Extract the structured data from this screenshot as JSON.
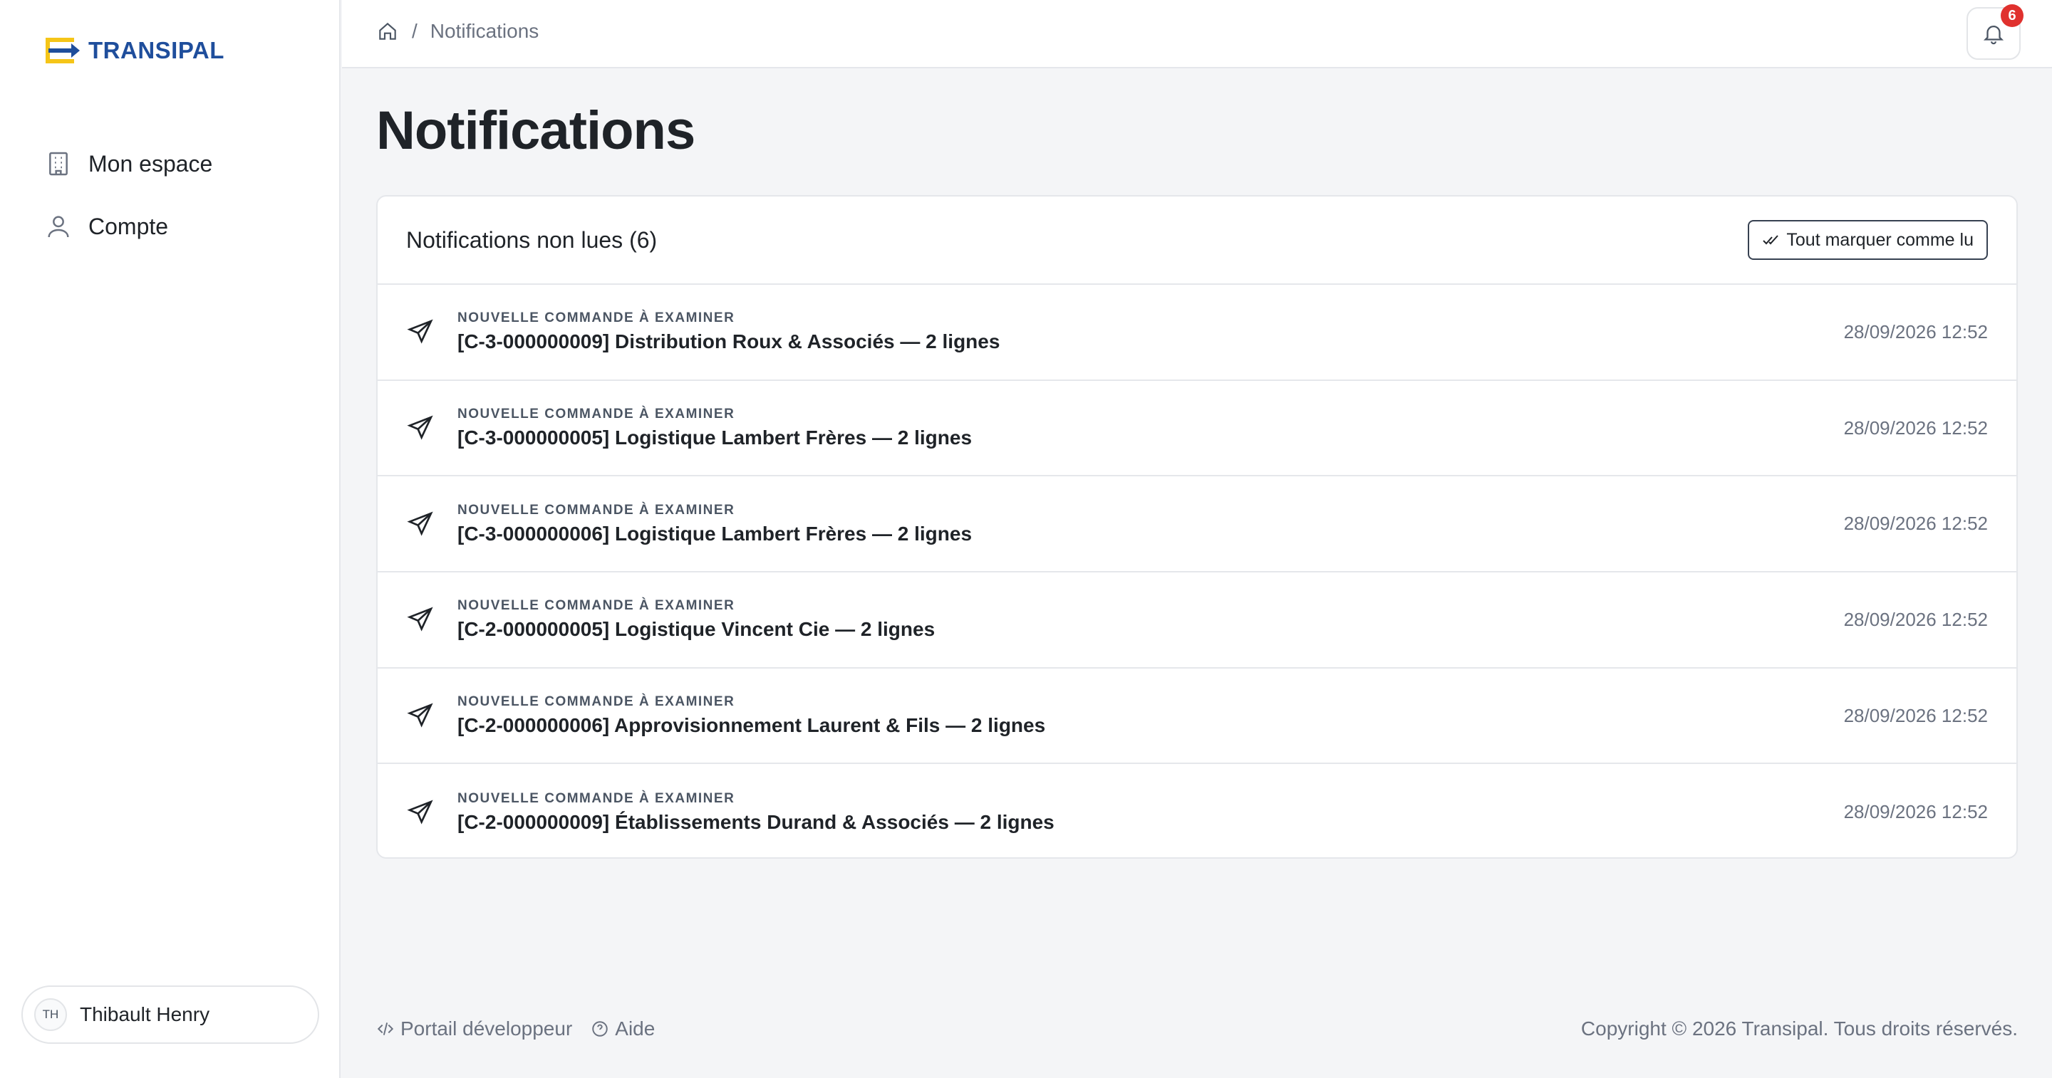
{
  "brand": {
    "name": "TRANSIPAL",
    "primary_color": "#1f4e9c",
    "accent_color": "#f5c518"
  },
  "sidebar": {
    "items": [
      {
        "label": "Mon espace",
        "icon": "building-icon"
      },
      {
        "label": "Compte",
        "icon": "user-icon"
      }
    ],
    "user": {
      "initials": "TH",
      "name": "Thibault Henry"
    }
  },
  "topbar": {
    "breadcrumb": {
      "home_icon": "home-icon",
      "separator": "/",
      "current": "Notifications"
    },
    "notifications_count": "6"
  },
  "main": {
    "title": "Notifications",
    "card_title": "Notifications non lues (6)",
    "mark_all_label": "Tout marquer comme lu",
    "notifications": [
      {
        "kind": "Nouvelle commande à examiner",
        "text": "[C-3-000000009] Distribution Roux & Associés — 2 lignes",
        "date": "28/09/2026 12:52"
      },
      {
        "kind": "Nouvelle commande à examiner",
        "text": "[C-3-000000005] Logistique Lambert Frères — 2 lignes",
        "date": "28/09/2026 12:52"
      },
      {
        "kind": "Nouvelle commande à examiner",
        "text": "[C-3-000000006] Logistique Lambert Frères — 2 lignes",
        "date": "28/09/2026 12:52"
      },
      {
        "kind": "Nouvelle commande à examiner",
        "text": "[C-2-000000005] Logistique Vincent Cie — 2 lignes",
        "date": "28/09/2026 12:52"
      },
      {
        "kind": "Nouvelle commande à examiner",
        "text": "[C-2-000000006] Approvisionnement Laurent & Fils — 2 lignes",
        "date": "28/09/2026 12:52"
      },
      {
        "kind": "Nouvelle commande à examiner",
        "text": "[C-2-000000009] Établissements Durand & Associés — 2 lignes",
        "date": "28/09/2026 12:52"
      }
    ]
  },
  "footer": {
    "dev_portal": "Portail développeur",
    "help": "Aide",
    "copyright": "Copyright © 2026 Transipal. Tous droits réservés."
  }
}
